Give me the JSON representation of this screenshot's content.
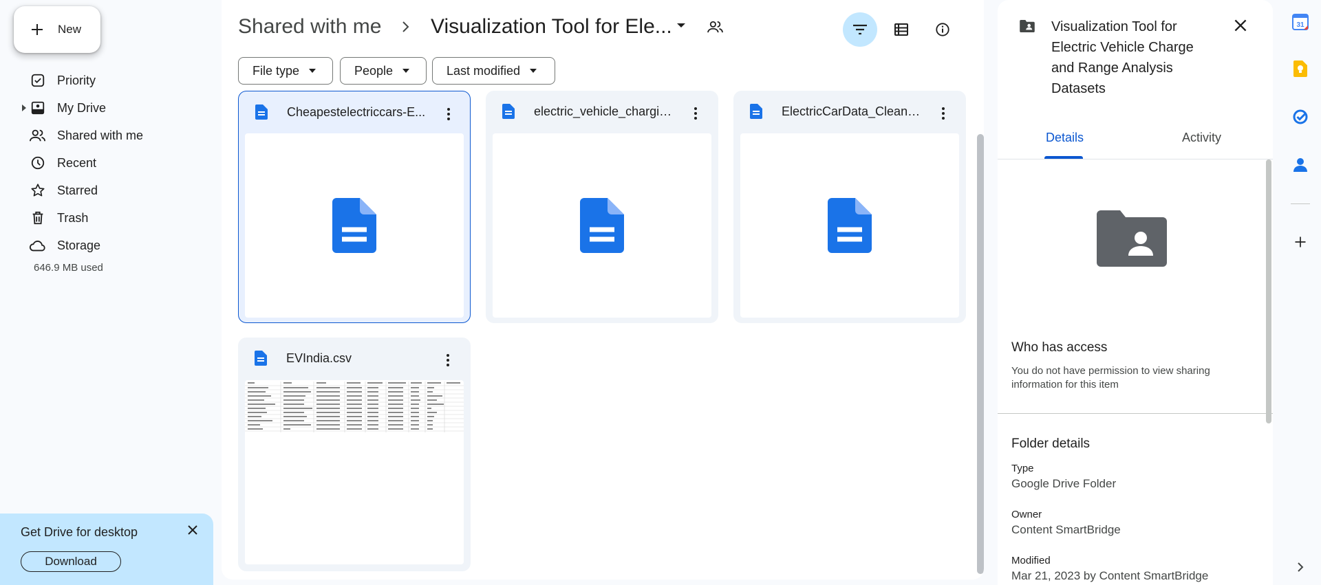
{
  "sidebar": {
    "new_label": "New",
    "items": [
      {
        "label": "Priority",
        "icon": "priority-icon"
      },
      {
        "label": "My Drive",
        "icon": "my-drive-icon"
      },
      {
        "label": "Shared with me",
        "icon": "shared-icon"
      },
      {
        "label": "Recent",
        "icon": "recent-icon"
      },
      {
        "label": "Starred",
        "icon": "star-icon"
      },
      {
        "label": "Trash",
        "icon": "trash-icon"
      },
      {
        "label": "Storage",
        "icon": "cloud-icon"
      }
    ],
    "storage_used": "646.9 MB used"
  },
  "promo": {
    "title": "Get Drive for desktop",
    "download_label": "Download"
  },
  "breadcrumb": {
    "root": "Shared with me",
    "current": "Visualization Tool for Ele..."
  },
  "filters": {
    "file_type": "File type",
    "people": "People",
    "last_modified": "Last modified"
  },
  "files": [
    {
      "name": "Cheapestelectriccars-E...",
      "thumb": "doc"
    },
    {
      "name": "electric_vehicle_chargin...",
      "thumb": "doc"
    },
    {
      "name": "ElectricCarData_Clean.csv",
      "thumb": "doc"
    },
    {
      "name": "EVIndia.csv",
      "thumb": "sheet-preview"
    }
  ],
  "details": {
    "title": "Visualization Tool for Electric Vehicle Charge and Range Analysis Datasets",
    "tabs": [
      "Details",
      "Activity"
    ],
    "access_heading": "Who has access",
    "access_text": "You do not have permission to view sharing information for this item",
    "folder_details_heading": "Folder details",
    "type_label": "Type",
    "type_value": "Google Drive Folder",
    "owner_label": "Owner",
    "owner_value": "Content SmartBridge",
    "modified_label": "Modified",
    "modified_value": "Mar 21, 2023 by Content SmartBridge"
  },
  "colors": {
    "accent": "#0b57d0",
    "doc_blue": "#1a73e8",
    "selected_chip": "#c2e7ff"
  }
}
